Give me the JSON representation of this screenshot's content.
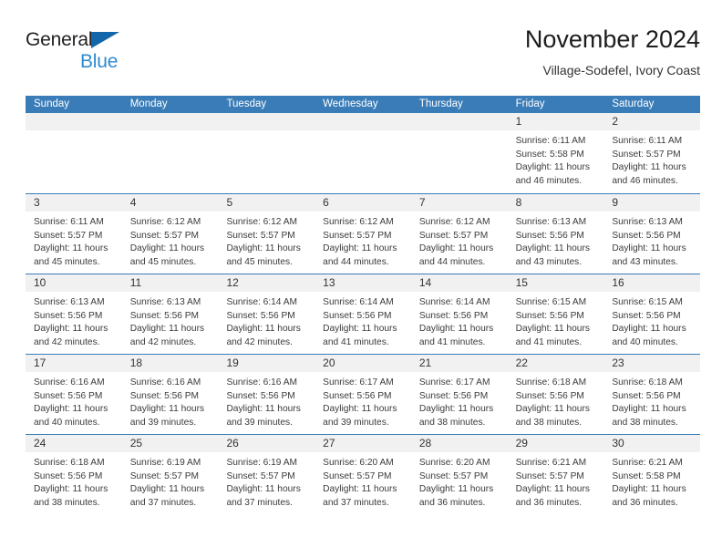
{
  "brand": {
    "line1": "General",
    "line2": "Blue",
    "triangle_color": "#1466ab",
    "line2_color": "#2e8bd0"
  },
  "header": {
    "title": "November 2024",
    "subtitle": "Village-Sodefel, Ivory Coast"
  },
  "theme": {
    "header_blue": "#3a7cb8",
    "daynum_band": "#f1f1f1",
    "text": "#3b3b3b"
  },
  "calendar": {
    "weekdays": [
      "Sunday",
      "Monday",
      "Tuesday",
      "Wednesday",
      "Thursday",
      "Friday",
      "Saturday"
    ],
    "weeks": [
      [
        {
          "day": ""
        },
        {
          "day": ""
        },
        {
          "day": ""
        },
        {
          "day": ""
        },
        {
          "day": ""
        },
        {
          "day": "1",
          "sunrise": "Sunrise: 6:11 AM",
          "sunset": "Sunset: 5:58 PM",
          "daylight": "Daylight: 11 hours and 46 minutes."
        },
        {
          "day": "2",
          "sunrise": "Sunrise: 6:11 AM",
          "sunset": "Sunset: 5:57 PM",
          "daylight": "Daylight: 11 hours and 46 minutes."
        }
      ],
      [
        {
          "day": "3",
          "sunrise": "Sunrise: 6:11 AM",
          "sunset": "Sunset: 5:57 PM",
          "daylight": "Daylight: 11 hours and 45 minutes."
        },
        {
          "day": "4",
          "sunrise": "Sunrise: 6:12 AM",
          "sunset": "Sunset: 5:57 PM",
          "daylight": "Daylight: 11 hours and 45 minutes."
        },
        {
          "day": "5",
          "sunrise": "Sunrise: 6:12 AM",
          "sunset": "Sunset: 5:57 PM",
          "daylight": "Daylight: 11 hours and 45 minutes."
        },
        {
          "day": "6",
          "sunrise": "Sunrise: 6:12 AM",
          "sunset": "Sunset: 5:57 PM",
          "daylight": "Daylight: 11 hours and 44 minutes."
        },
        {
          "day": "7",
          "sunrise": "Sunrise: 6:12 AM",
          "sunset": "Sunset: 5:57 PM",
          "daylight": "Daylight: 11 hours and 44 minutes."
        },
        {
          "day": "8",
          "sunrise": "Sunrise: 6:13 AM",
          "sunset": "Sunset: 5:56 PM",
          "daylight": "Daylight: 11 hours and 43 minutes."
        },
        {
          "day": "9",
          "sunrise": "Sunrise: 6:13 AM",
          "sunset": "Sunset: 5:56 PM",
          "daylight": "Daylight: 11 hours and 43 minutes."
        }
      ],
      [
        {
          "day": "10",
          "sunrise": "Sunrise: 6:13 AM",
          "sunset": "Sunset: 5:56 PM",
          "daylight": "Daylight: 11 hours and 42 minutes."
        },
        {
          "day": "11",
          "sunrise": "Sunrise: 6:13 AM",
          "sunset": "Sunset: 5:56 PM",
          "daylight": "Daylight: 11 hours and 42 minutes."
        },
        {
          "day": "12",
          "sunrise": "Sunrise: 6:14 AM",
          "sunset": "Sunset: 5:56 PM",
          "daylight": "Daylight: 11 hours and 42 minutes."
        },
        {
          "day": "13",
          "sunrise": "Sunrise: 6:14 AM",
          "sunset": "Sunset: 5:56 PM",
          "daylight": "Daylight: 11 hours and 41 minutes."
        },
        {
          "day": "14",
          "sunrise": "Sunrise: 6:14 AM",
          "sunset": "Sunset: 5:56 PM",
          "daylight": "Daylight: 11 hours and 41 minutes."
        },
        {
          "day": "15",
          "sunrise": "Sunrise: 6:15 AM",
          "sunset": "Sunset: 5:56 PM",
          "daylight": "Daylight: 11 hours and 41 minutes."
        },
        {
          "day": "16",
          "sunrise": "Sunrise: 6:15 AM",
          "sunset": "Sunset: 5:56 PM",
          "daylight": "Daylight: 11 hours and 40 minutes."
        }
      ],
      [
        {
          "day": "17",
          "sunrise": "Sunrise: 6:16 AM",
          "sunset": "Sunset: 5:56 PM",
          "daylight": "Daylight: 11 hours and 40 minutes."
        },
        {
          "day": "18",
          "sunrise": "Sunrise: 6:16 AM",
          "sunset": "Sunset: 5:56 PM",
          "daylight": "Daylight: 11 hours and 39 minutes."
        },
        {
          "day": "19",
          "sunrise": "Sunrise: 6:16 AM",
          "sunset": "Sunset: 5:56 PM",
          "daylight": "Daylight: 11 hours and 39 minutes."
        },
        {
          "day": "20",
          "sunrise": "Sunrise: 6:17 AM",
          "sunset": "Sunset: 5:56 PM",
          "daylight": "Daylight: 11 hours and 39 minutes."
        },
        {
          "day": "21",
          "sunrise": "Sunrise: 6:17 AM",
          "sunset": "Sunset: 5:56 PM",
          "daylight": "Daylight: 11 hours and 38 minutes."
        },
        {
          "day": "22",
          "sunrise": "Sunrise: 6:18 AM",
          "sunset": "Sunset: 5:56 PM",
          "daylight": "Daylight: 11 hours and 38 minutes."
        },
        {
          "day": "23",
          "sunrise": "Sunrise: 6:18 AM",
          "sunset": "Sunset: 5:56 PM",
          "daylight": "Daylight: 11 hours and 38 minutes."
        }
      ],
      [
        {
          "day": "24",
          "sunrise": "Sunrise: 6:18 AM",
          "sunset": "Sunset: 5:56 PM",
          "daylight": "Daylight: 11 hours and 38 minutes."
        },
        {
          "day": "25",
          "sunrise": "Sunrise: 6:19 AM",
          "sunset": "Sunset: 5:57 PM",
          "daylight": "Daylight: 11 hours and 37 minutes."
        },
        {
          "day": "26",
          "sunrise": "Sunrise: 6:19 AM",
          "sunset": "Sunset: 5:57 PM",
          "daylight": "Daylight: 11 hours and 37 minutes."
        },
        {
          "day": "27",
          "sunrise": "Sunrise: 6:20 AM",
          "sunset": "Sunset: 5:57 PM",
          "daylight": "Daylight: 11 hours and 37 minutes."
        },
        {
          "day": "28",
          "sunrise": "Sunrise: 6:20 AM",
          "sunset": "Sunset: 5:57 PM",
          "daylight": "Daylight: 11 hours and 36 minutes."
        },
        {
          "day": "29",
          "sunrise": "Sunrise: 6:21 AM",
          "sunset": "Sunset: 5:57 PM",
          "daylight": "Daylight: 11 hours and 36 minutes."
        },
        {
          "day": "30",
          "sunrise": "Sunrise: 6:21 AM",
          "sunset": "Sunset: 5:58 PM",
          "daylight": "Daylight: 11 hours and 36 minutes."
        }
      ]
    ]
  }
}
